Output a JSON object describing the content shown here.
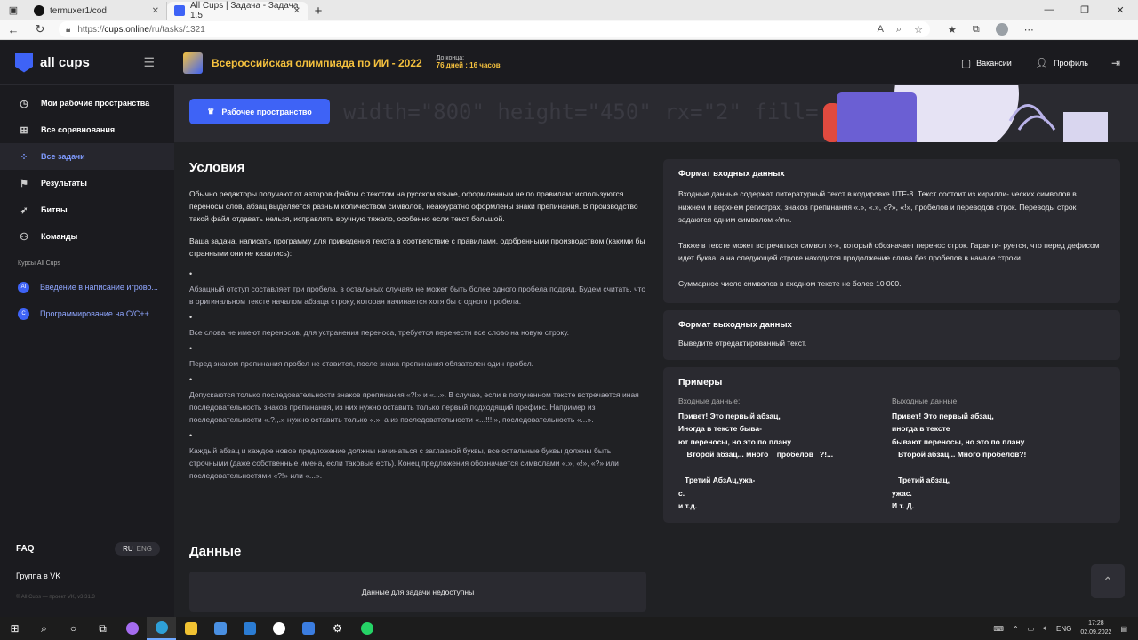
{
  "browser": {
    "tabs": [
      {
        "title": "termuxer1/cod",
        "active": false
      },
      {
        "title": "All Cups | Задача - Задача 1.5",
        "active": true
      }
    ],
    "url_prefix": "https://",
    "url_host": "cups.online",
    "url_path": "/ru/tasks/1321"
  },
  "header": {
    "logo": "all cups",
    "olympiad_title": "Всероссийская олимпиада по ИИ - 2022",
    "deadline_label": "До конца:",
    "deadline_value": "76 дней : 16 часов",
    "vacancies": "Вакансии",
    "profile": "Профиль"
  },
  "sidebar": {
    "items": [
      {
        "label": "Мои рабочие пространства",
        "icon": "clock-icon"
      },
      {
        "label": "Все соревнования",
        "icon": "grid-icon"
      },
      {
        "label": "Все задачи",
        "icon": "nodes-icon",
        "active": true
      },
      {
        "label": "Результаты",
        "icon": "flag-icon"
      },
      {
        "label": "Битвы",
        "icon": "rocket-icon"
      },
      {
        "label": "Команды",
        "icon": "team-icon"
      }
    ],
    "courses_section": "Курсы All Cups",
    "courses": [
      {
        "label": "Введение в написание игрово...",
        "icon_text": "AI"
      },
      {
        "label": "Программирование на C/C++",
        "icon_text": "C"
      }
    ],
    "faq": "FAQ",
    "lang_ru": "RU",
    "lang_eng": "ENG",
    "vk_group": "Группа в VK",
    "copyright": "© All Cups — проект VK, v3.31.3"
  },
  "main": {
    "workspace_button": "Рабочее пространство",
    "conditions_title": "Условия",
    "intro": "Обычно редакторы получают от авторов файлы с текстом на русском языке, оформленным не по правилам: используются переносы слов, абзац выделяется разным количеством символов, неаккуратно оформлены знаки препинания. В производство такой файл отдавать нельзя, исправлять вручную тяжело, особенно если текст большой.",
    "task": "Ваша задача, написать программу для приведения текста в соответствие с правилами, одобренными производством (какими бы странными они не казались):",
    "rules": [
      "Абзацный отступ составляет три пробела, в остальных случаях не может быть более одного пробела подряд. Будем считать, что в оригинальном тексте началом абзаца строку, которая начинается хотя бы с одного пробела.",
      "Все слова не имеют переносов, для устранения переноса, требуется перенести все слово на новую строку.",
      "Перед знаком препинания пробел не ставится, после знака препинания обязателен один пробел.",
      "Допускаются только последовательности знаков препинания «?!» и «...». В случае, если в полученном тексте встречается иная последовательность знаков препинания, из них нужно оставить только первый подходящий префикс. Например из последовательности «.?,,.» нужно оставить только «.», а из последовательности «...!!!.», последовательность «...».",
      "Каждый абзац и каждое новое предложение должны начинаться с заглавной буквы, все остальные буквы должны быть строчными (даже собственные имена, если таковые есть). Конец предложения обозначается символами «.», «!», «?» или последовательностями «?!» или «...»."
    ],
    "data_title": "Данные",
    "data_unavailable": "Данные для задачи недоступны",
    "input_format_title": "Формат входных данных",
    "input_format_p1": "Входные данные содержат литературный текст в кодировке UTF-8. Текст состоит из кирилли- ческих символов в нижнем и верхнем регистрах, знаков препинания «.», «.», «?», «!», пробелов и переводов строк. Переводы строк задаются одним символом «\\n».",
    "input_format_p2": "Также в тексте может встречаться символ «-», который обозначает перенос строк. Гаранти- руется, что перед дефисом идет буква, а на следующей строке находится продолжение слова без пробелов в начале строки.",
    "input_format_p3": "Суммарное число символов в входном тексте не более 10 000.",
    "output_format_title": "Формат выходных данных",
    "output_format_text": "Выведите отредактированный текст.",
    "examples_title": "Примеры",
    "input_label": "Входные данные:",
    "output_label": "Выходные данные:",
    "example_input": "Привет! Это первый абзац,\nИногда в тексте быва-\nют переносы, но это по плану\n    Второй абзац... много    пробелов   ?!...\n\n   Третий АбзАц,ужа-\nс.\nи т.д.",
    "example_output": "Привет! Это первый абзац,\nиногда в тексте\nбывают переносы, но это по плану\n   Второй абзац... Много пробелов?!\n\n   Третий абзац,\nужас.\nИ т. Д."
  },
  "taskbar": {
    "lang": "ENG",
    "time": "17:28",
    "date": "02.09.2022"
  },
  "colors": {
    "accent": "#3e63f6",
    "gold": "#f6c23e",
    "bg": "#202124",
    "panel": "#2a2a30"
  }
}
